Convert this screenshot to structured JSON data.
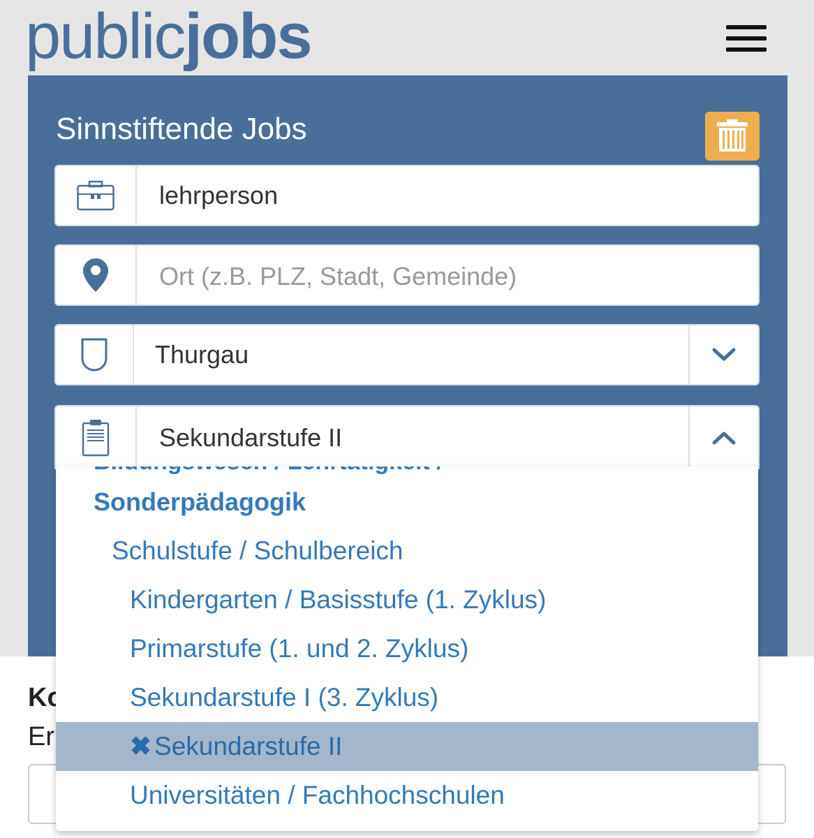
{
  "header": {
    "logo_part1": "public",
    "logo_part2": "jobs",
    "menu_icon": "hamburger-menu-icon"
  },
  "search": {
    "title": "Sinnstiftende Jobs",
    "reset_icon": "trash-icon",
    "keyword": {
      "icon": "briefcase-icon",
      "value": "lehrperson"
    },
    "location": {
      "icon": "map-pin-icon",
      "placeholder": "Ort (z.B. PLZ, Stadt, Gemeinde)"
    },
    "canton": {
      "icon": "shield-icon",
      "value": "Thurgau",
      "chevron_icon": "chevron-down-icon"
    },
    "category": {
      "icon": "clipboard-icon",
      "value": "Sekundarstufe II",
      "chevron_icon": "chevron-up-icon"
    }
  },
  "dropdown": {
    "cut_label": "Bildungswesen / Lehrtätigkeit /",
    "group": "Sonderpädagogik",
    "subgroup": "Schulstufe / Schulbereich",
    "items": [
      {
        "label": "Kindergarten / Basisstufe (1. Zyklus)",
        "selected": false
      },
      {
        "label": "Primarstufe (1. und 2. Zyklus)",
        "selected": false
      },
      {
        "label": "Sekundarstufe I (3. Zyklus)",
        "selected": false
      },
      {
        "label": "Sekundarstufe II",
        "selected": true,
        "marker": "✖"
      },
      {
        "label": "Universitäten / Fachhochschulen",
        "selected": false
      }
    ]
  },
  "below": {
    "text1": "Ko",
    "text2": "Er"
  },
  "colors": {
    "brand": "#4a6e9a",
    "link": "#337ab7",
    "reset_button": "#f0ad4e",
    "selected_row": "#a3b6cb"
  }
}
